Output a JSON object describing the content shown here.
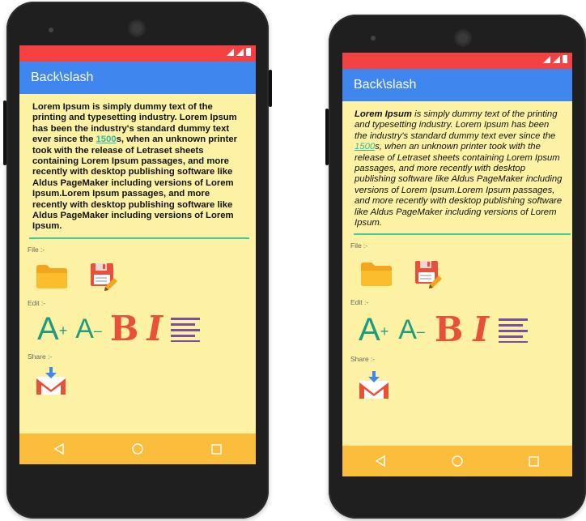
{
  "app": {
    "title": "Back\\slash"
  },
  "left_text": {
    "before_link": "Lorem Ipsum is simply dummy text of the printing and typesetting industry. Lorem Ipsum has been the industry's standard dummy text ever since the ",
    "link": "1500",
    "after_link": "s, when an unknown printer took with the release of Letraset sheets containing Lorem Ipsum passages, and more recently with desktop publishing software like Aldus PageMaker including versions of Lorem Ipsum.Lorem Ipsum passages, and more recently with desktop publishing software like Aldus PageMaker including versions of Lorem Ipsum."
  },
  "right_text": {
    "bold_start": "Lorem Ipsum",
    "before_link": " is simply dummy text of the printing and typesetting industry. Lorem Ipsum has been the industry's standard dummy text ever since the ",
    "link": "1500",
    "after_link": "s, when an unknown printer took with the release of Letraset sheets containing Lorem Ipsum passages, and more recently with desktop publishing software like Aldus PageMaker including versions of Lorem Ipsum.Lorem Ipsum passages, and more recently with desktop publishing software like Aldus PageMaker including versions of Lorem Ipsum."
  },
  "sections": {
    "file": "File :-",
    "edit": "Edit :-",
    "share": "Share :-"
  },
  "colors": {
    "status_bar": "#f44242",
    "toolbar": "#3f86ee",
    "screen_background": "#fdf2a4",
    "nav_bar": "#fbbe3c",
    "divider": "#3dcf9b",
    "accent_green": "#1f9b82",
    "accent_red": "#e8503a",
    "align_purple": "#7b4fa0"
  },
  "icons": [
    "folder-icon",
    "save-icon",
    "increase-font-icon",
    "decrease-font-icon",
    "bold-icon",
    "italic-icon",
    "align-justify-icon",
    "gmail-icon",
    "back-icon",
    "home-icon",
    "recents-icon"
  ]
}
